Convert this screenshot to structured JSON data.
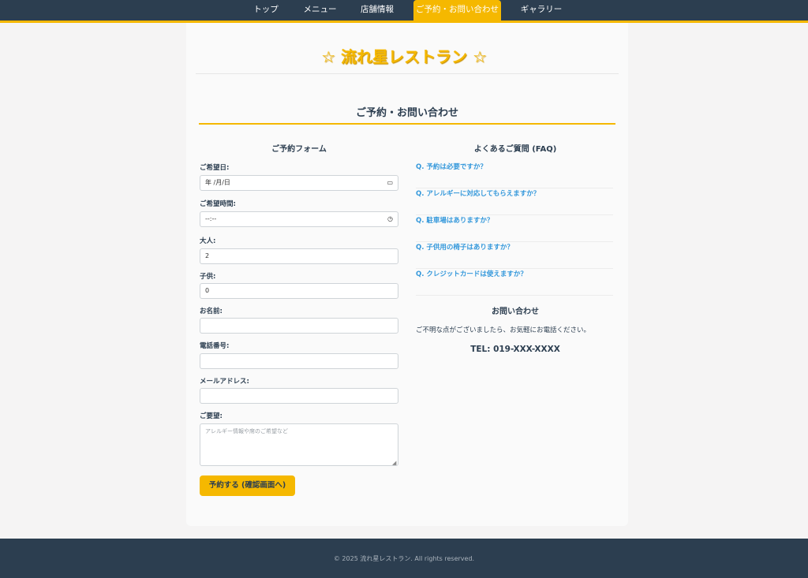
{
  "nav": {
    "items": [
      {
        "label": "トップ"
      },
      {
        "label": "メニュー"
      },
      {
        "label": "店舗情報"
      },
      {
        "label": "ご予約・お問い合わせ",
        "active": true
      },
      {
        "label": "ギャラリー"
      }
    ]
  },
  "site": {
    "title": "☆ 流れ星レストラン ☆"
  },
  "page": {
    "section_title": "ご予約・お問い合わせ"
  },
  "form": {
    "heading": "ご予約フォーム",
    "date_label": "ご希望日:",
    "date_value": "年 /月/日",
    "time_label": "ご希望時間:",
    "time_value": "--:--",
    "adults_label": "大人:",
    "adults_value": "2",
    "children_label": "子供:",
    "children_value": "0",
    "name_label": "お名前:",
    "phone_label": "電話番号:",
    "email_label": "メールアドレス:",
    "request_label": "ご要望:",
    "request_placeholder": "アレルギー情報や席のご希望など",
    "submit_label": "予約する (確認画面へ)"
  },
  "faq": {
    "heading": "よくあるご質問 (FAQ)",
    "items": [
      "Q. 予約は必要ですか？",
      "Q. アレルギーに対応してもらえますか？",
      "Q. 駐車場はありますか？",
      "Q. 子供用の椅子はありますか？",
      "Q. クレジットカードは使えますか？"
    ]
  },
  "contact": {
    "heading": "お問い合わせ",
    "text": "ご不明な点がございましたら、お気軽にお電話ください。",
    "tel": "TEL: 019-XXX-XXXX"
  },
  "footer": {
    "text": "© 2025 流れ星レストラン. All rights reserved."
  },
  "icons": {
    "calendar": "calendar-icon",
    "clock": "clock-icon"
  },
  "colors": {
    "accent": "#f5b800",
    "nav_bg": "#2c3e50",
    "link": "#3498db"
  }
}
